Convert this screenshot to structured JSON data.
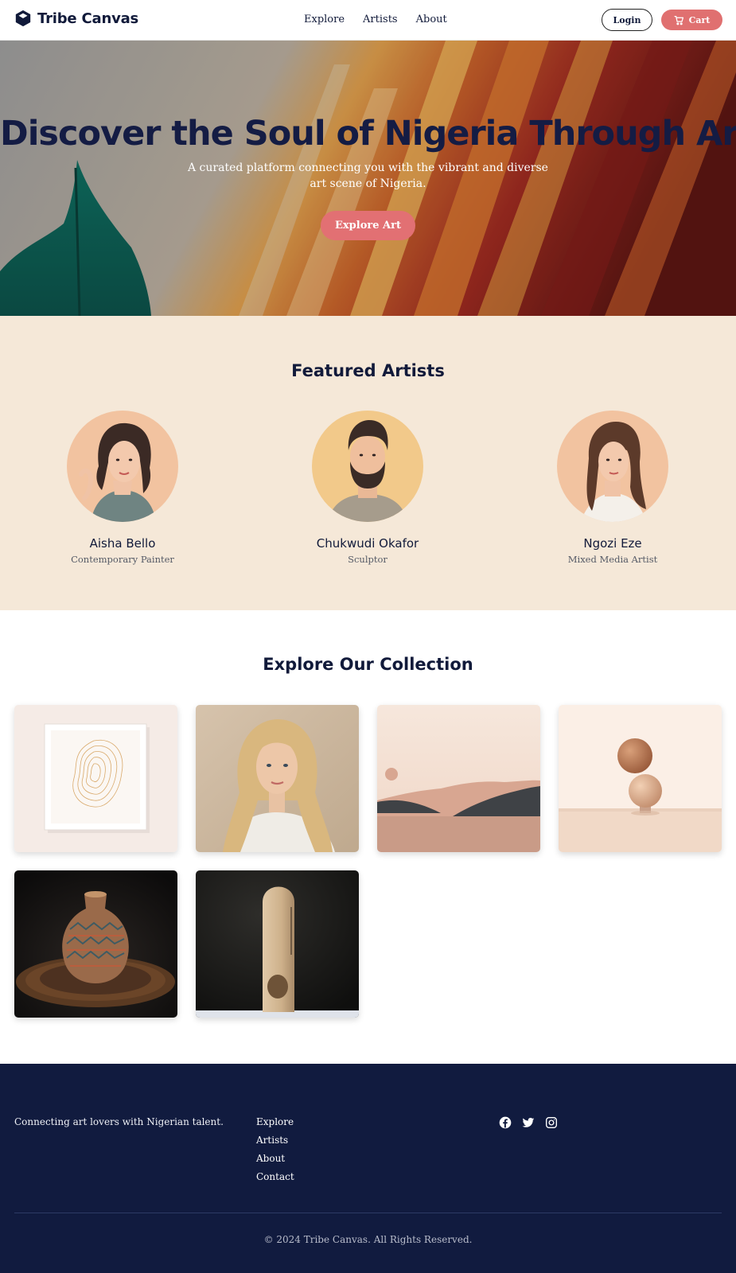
{
  "nav": {
    "brand": "Tribe Canvas",
    "links": [
      "Explore",
      "Artists",
      "About"
    ],
    "login_label": "Login",
    "cart_label": "Cart"
  },
  "hero": {
    "title": "Discover the Soul of Nigeria Through Art",
    "subtitle": "A curated platform connecting you with the vibrant and diverse art scene of Nigeria.",
    "button_label": "Explore Art"
  },
  "featured": {
    "title": "Featured Artists",
    "artists": [
      {
        "name": "Aisha Bello",
        "role": "Contemporary Painter"
      },
      {
        "name": "Chukwudi Okafor",
        "role": "Sculptor"
      },
      {
        "name": "Ngozi Eze",
        "role": "Mixed Media Artist"
      }
    ]
  },
  "collection": {
    "title": "Explore Our Collection",
    "items": [
      "framed-line-art",
      "portrait-painting",
      "desert-landscape",
      "stacked-spheres",
      "patterned-vase",
      "stone-sculpture"
    ]
  },
  "footer": {
    "tagline": "Connecting art lovers with Nigerian talent.",
    "links": [
      "Explore",
      "Artists",
      "About",
      "Contact"
    ],
    "socials": [
      "facebook-icon",
      "twitter-icon",
      "instagram-icon"
    ],
    "copyright": "© 2024 Tribe Canvas. All Rights Reserved."
  },
  "colors": {
    "navy": "#111b3f",
    "accent": "#e27073",
    "cream": "#f5e8d8"
  }
}
